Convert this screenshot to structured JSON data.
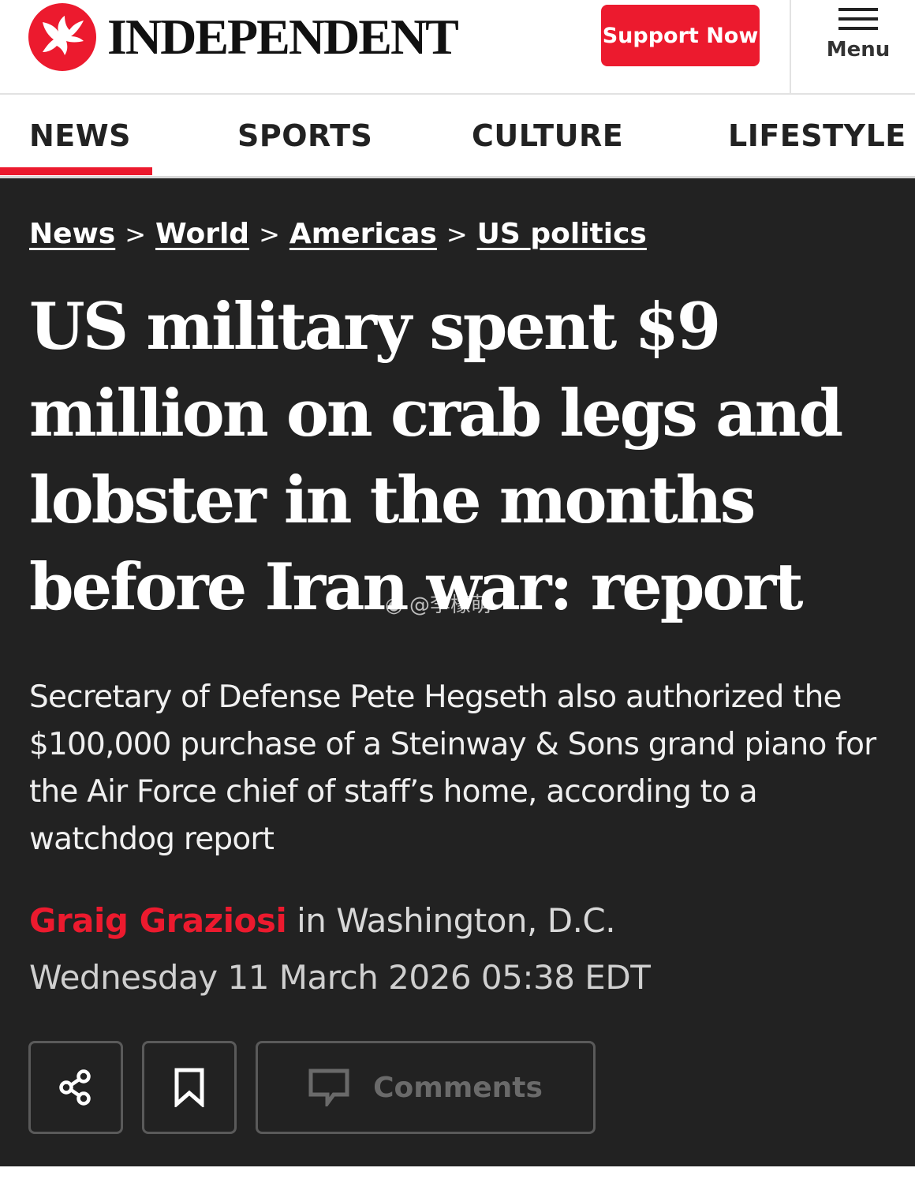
{
  "header": {
    "logo_text": "INDEPENDENT",
    "support_label": "Support Now",
    "menu_label": "Menu"
  },
  "nav": {
    "items": [
      {
        "label": "NEWS",
        "active": true
      },
      {
        "label": "SPORTS"
      },
      {
        "label": "CULTURE"
      },
      {
        "label": "LIFESTYLE"
      }
    ]
  },
  "breadcrumb": {
    "items": [
      "News",
      "World",
      "Americas",
      "US politics"
    ],
    "separator": ">"
  },
  "article": {
    "headline_lines": [
      "US military spent $9",
      "million on crab legs and",
      "lobster in the months",
      "before Iran war: report"
    ],
    "standfirst": "Secretary of Defense Pete Hegseth also authorized the $100,000 purchase of a Steinway & Sons grand piano for the Air Force chief of staff’s home, according to a watchdog report",
    "author": "Graig Graziosi",
    "location": " in Washington, D.C.",
    "date": "Wednesday 11 March 2026 05:38 EDT",
    "comments_label": "Comments"
  },
  "watermark": "@李檬萌",
  "colors": {
    "brand_red": "#ec1a2e",
    "article_bg": "#222222"
  },
  "icons": [
    "eagle-logo-icon",
    "hamburger-icon",
    "share-icon",
    "bookmark-icon",
    "comment-icon",
    "weibo-icon"
  ]
}
